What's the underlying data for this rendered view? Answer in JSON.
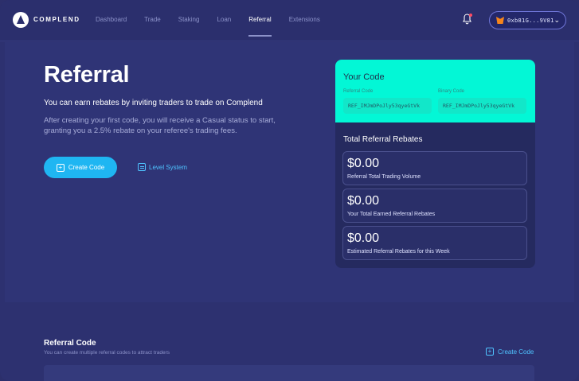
{
  "brand": "COMPLEND",
  "nav": [
    "Dashboard",
    "Trade",
    "Staking",
    "Loan",
    "Referral",
    "Extensions"
  ],
  "wallet": {
    "address": "0xb81G...9V81"
  },
  "hero": {
    "title": "Referral",
    "subtitle": "You can earn rebates by inviting traders to trade on Complend",
    "description": "After creating your first code, you will receive a Casual status to start, granting you a 2.5% rebate on your referee's trading fees.",
    "create_button": "Create Code",
    "level_link": "Level System"
  },
  "code_card": {
    "title": "Your Code",
    "referral_label": "Referral Code",
    "referral_code": "REF_IMJmDPoJly53qyeGtVk",
    "binary_label": "Binary Code",
    "binary_code": "REF_IMJmDPoJly53qyeGtVk"
  },
  "rebates": {
    "title": "Total Referral Rebates",
    "stats": [
      {
        "value": "$0.00",
        "label": "Referral Total Trading Volume"
      },
      {
        "value": "$0.00",
        "label": "Your Total Earned Referral Rebates"
      },
      {
        "value": "$0.00",
        "label": "Estimated Referral Rebates for this Week"
      }
    ]
  },
  "referral_code_section": {
    "title": "Referral Code",
    "subtitle": "You can create multiple referral codes to attract traders",
    "create_link": "Create Code"
  },
  "colors": {
    "accent": "#03f7d6",
    "button": "#1fb6f2",
    "link": "#4fc3ff",
    "bg": "#2d3170"
  }
}
